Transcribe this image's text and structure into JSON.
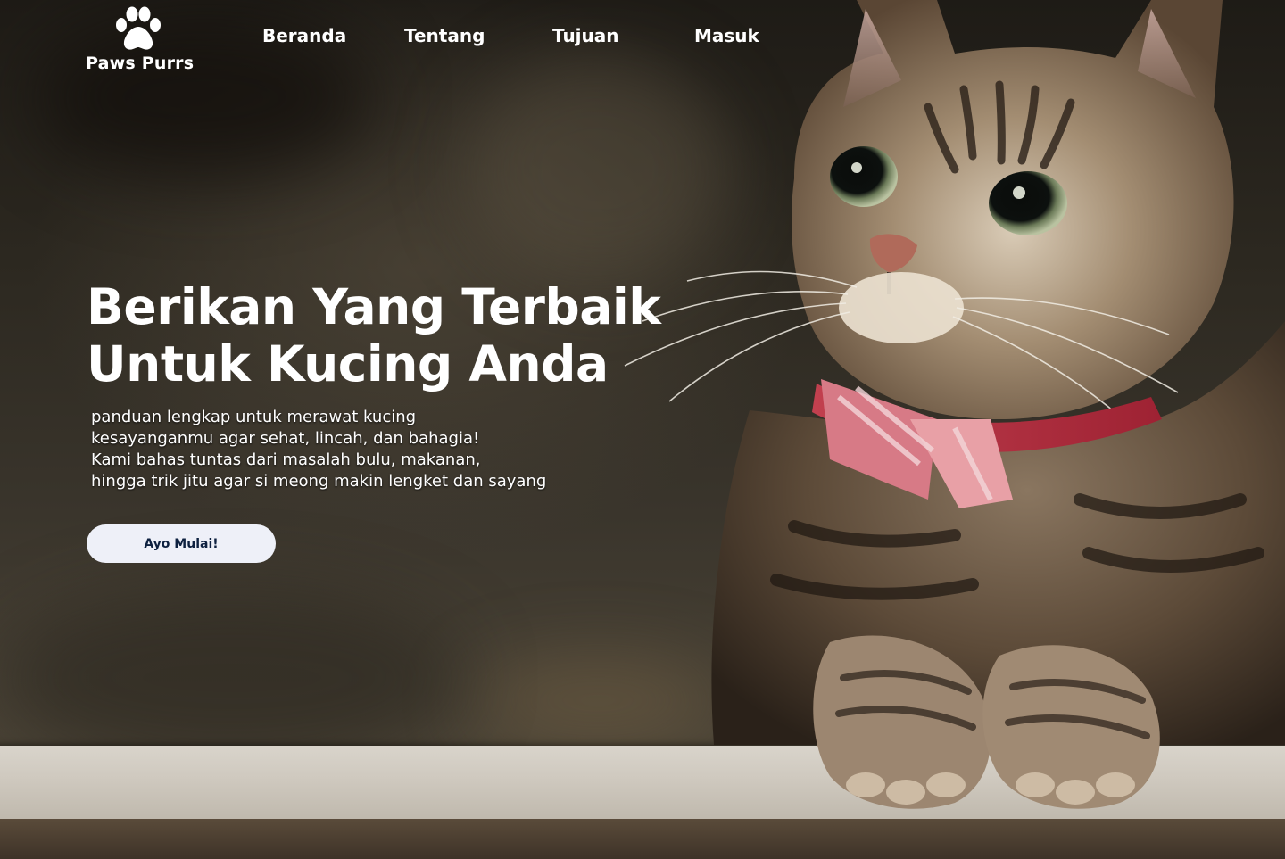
{
  "brand": {
    "name": "Paws Purrs",
    "icon": "paw-icon"
  },
  "nav": {
    "items": [
      {
        "label": "Beranda"
      },
      {
        "label": "Tentang"
      },
      {
        "label": "Tujuan"
      },
      {
        "label": "Masuk"
      }
    ]
  },
  "hero": {
    "headline_line1": "Berikan Yang Terbaik",
    "headline_line2": "Untuk Kucing Anda",
    "subtitle_lines": [
      "panduan lengkap untuk merawat kucing",
      "kesayanganmu agar sehat, lincah, dan bahagia!",
      "Kami bahas tuntas dari masalah bulu, makanan,",
      "hingga trik jitu agar si meong makin lengket dan sayang"
    ],
    "cta_label": "Ayo Mulai!",
    "image": "tabby-cat-photo"
  },
  "colors": {
    "text": "#ffffff",
    "button_bg": "#eef0f8",
    "button_text": "#0e2140"
  }
}
